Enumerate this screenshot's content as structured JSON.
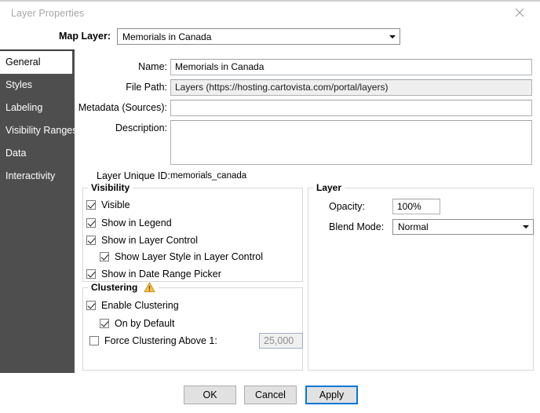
{
  "window": {
    "title": "Layer Properties",
    "close_icon": "close-icon"
  },
  "map_layer": {
    "label": "Map Layer:",
    "value": "Memorials in Canada"
  },
  "sidebar": {
    "items": [
      {
        "label": "General",
        "active": true
      },
      {
        "label": "Styles",
        "active": false
      },
      {
        "label": "Labeling",
        "active": false
      },
      {
        "label": "Visibility Ranges",
        "active": false
      },
      {
        "label": "Data",
        "active": false
      },
      {
        "label": "Interactivity",
        "active": false
      }
    ]
  },
  "general": {
    "fields": [
      {
        "label": "Name:",
        "value": "Memorials in Canada"
      },
      {
        "label": "File Path:",
        "value": "Layers (https://hosting.cartovista.com/portal/layers)"
      },
      {
        "label": "Metadata (Sources):",
        "value": ""
      },
      {
        "label": "Description:",
        "value": ""
      }
    ],
    "unique_id_label": "Layer Unique ID:",
    "unique_id_value": "memorials_canada"
  },
  "visibility": {
    "title": "Visibility",
    "items": [
      {
        "label": "Visible",
        "checked": true
      },
      {
        "label": "Show in Legend",
        "checked": true
      },
      {
        "label": "Show in Layer Control",
        "checked": true
      },
      {
        "label": "Show Layer Style in Layer Control",
        "checked": true
      },
      {
        "label": "Show in Date Range Picker",
        "checked": true
      }
    ]
  },
  "clustering": {
    "title": "Clustering",
    "warning_icon": "warning-triangle-icon",
    "items": [
      {
        "label": "Enable Clustering",
        "checked": true
      },
      {
        "label": "On by Default",
        "checked": true
      },
      {
        "label": "Force Clustering Above 1:",
        "checked": false
      }
    ],
    "threshold_value": "25,000"
  },
  "layer": {
    "title": "Layer",
    "opacity_label": "Opacity:",
    "opacity_value": "100%",
    "blend_label": "Blend Mode:",
    "blend_value": "Normal"
  },
  "buttons": {
    "ok": "OK",
    "cancel": "Cancel",
    "apply": "Apply"
  },
  "colors": {
    "sidebar_bg": "#4e4e4e",
    "focus_blue": "#0078d7",
    "warning": "#f0b323"
  }
}
